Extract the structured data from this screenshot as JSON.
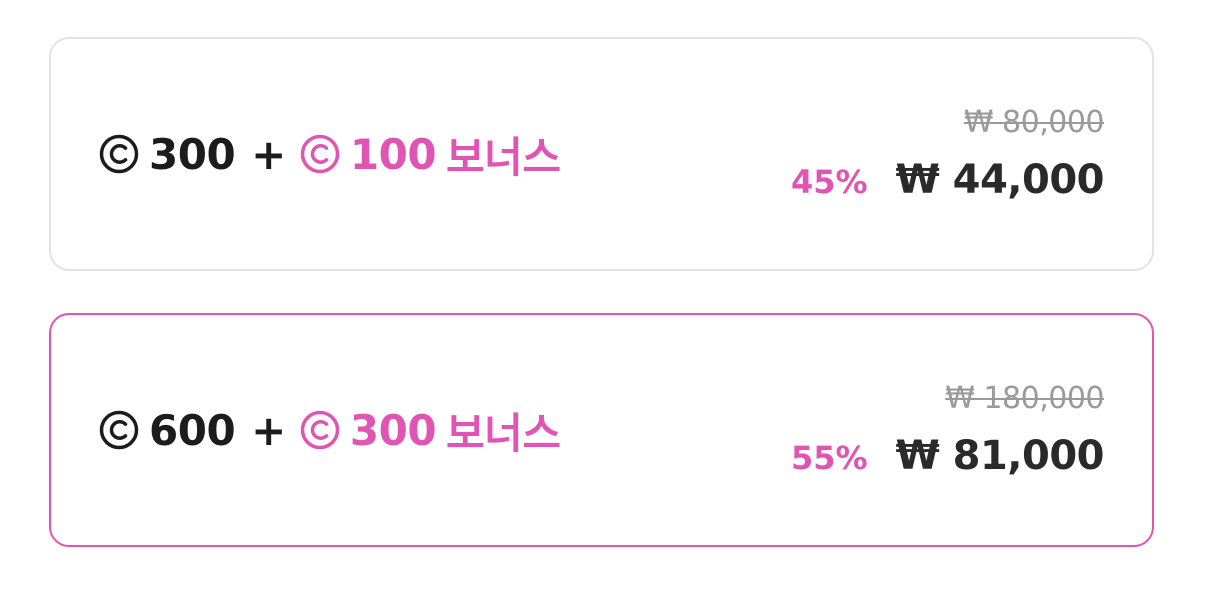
{
  "packages": [
    {
      "coins": "300",
      "plus": "+",
      "bonus_coins": "100",
      "bonus_label": "보너스",
      "original_price": "₩ 80,000",
      "discount": "45%",
      "price": "₩ 44,000",
      "selected": false
    },
    {
      "coins": "600",
      "plus": "+",
      "bonus_coins": "300",
      "bonus_label": "보너스",
      "original_price": "₩ 180,000",
      "discount": "55%",
      "price": "₩ 81,000",
      "selected": true
    }
  ],
  "icons": {
    "coin": "coin-icon"
  },
  "colors": {
    "accent": "#e055b4",
    "text": "#1c1c1c",
    "muted": "#9a9a9a",
    "border_default": "#e3e3e3"
  }
}
